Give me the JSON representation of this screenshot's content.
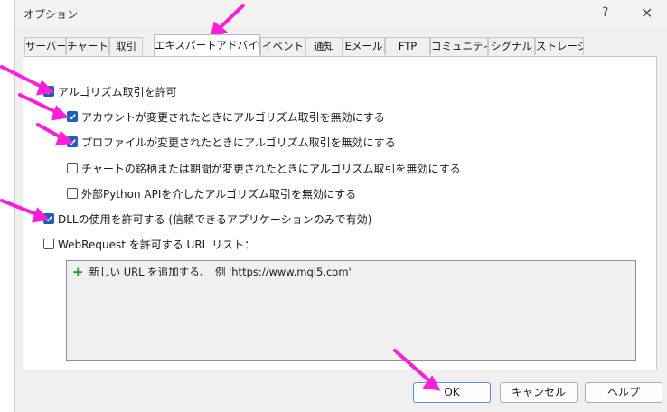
{
  "window": {
    "title": "オプション",
    "help": "?",
    "close": "✕"
  },
  "tabs": [
    {
      "label": "サーバー"
    },
    {
      "label": "チャート"
    },
    {
      "label": "取引"
    },
    {
      "label": "エキスパートアドバイザ"
    },
    {
      "label": "イベント"
    },
    {
      "label": "通知"
    },
    {
      "label": "Eメール"
    },
    {
      "label": "FTP"
    },
    {
      "label": "コミュニティー"
    },
    {
      "label": "シグナル"
    },
    {
      "label": "ストレージ"
    }
  ],
  "active_tab": "エキスパートアドバイザ",
  "options": [
    {
      "label": "アルゴリズム取引を許可",
      "checked": true
    },
    {
      "label": "アカウントが変更されたときにアルゴリズム取引を無効にする",
      "checked": true
    },
    {
      "label": "プロファイルが変更されたときにアルゴリズム取引を無効にする",
      "checked": true
    },
    {
      "label": "チャートの銘柄または期間が変更されたときにアルゴリズム取引を無効にする",
      "checked": false
    },
    {
      "label": "外部Python APIを介したアルゴリズム取引を無効にする",
      "checked": false
    },
    {
      "label": "DLLの使用を許可する (信頼できるアプリケーションのみで有効)",
      "checked": true
    },
    {
      "label": "WebRequest を許可する URL リスト：",
      "checked": false
    }
  ],
  "url_list": {
    "add_placeholder": "新しい URL を追加する、　例 'https://www.mql5.com'"
  },
  "buttons": {
    "ok": "OK",
    "cancel": "キャンセル",
    "help": "ヘルプ"
  },
  "colors": {
    "checkbox_checked": "#1f5fb5",
    "annotation_arrow": "#ff1fd6",
    "plus": "#1e9a2a"
  }
}
